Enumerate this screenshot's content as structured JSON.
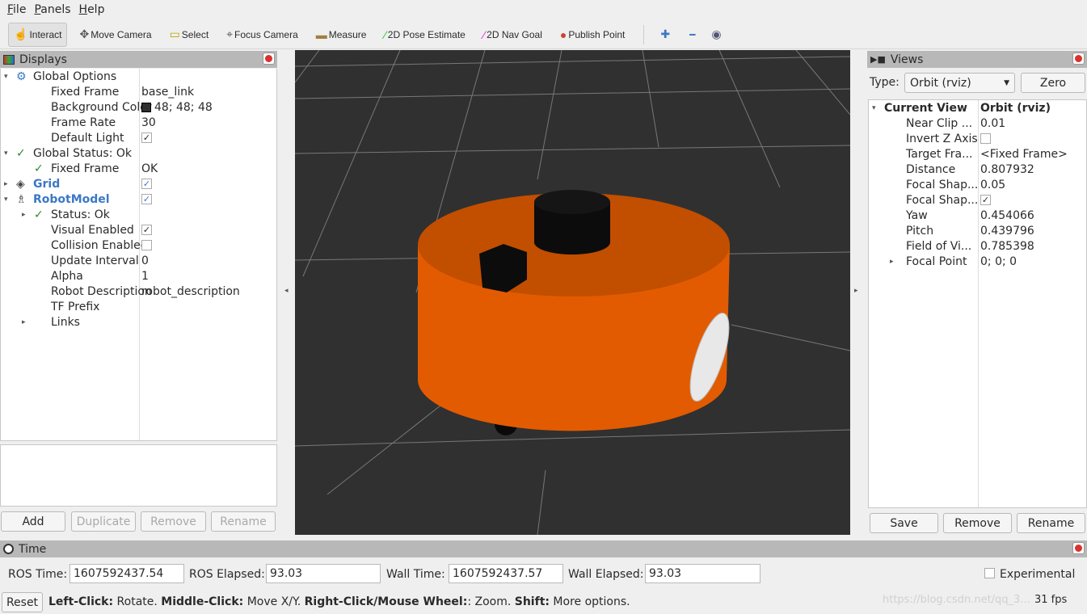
{
  "menu": [
    "File",
    "Panels",
    "Help"
  ],
  "toolbar": {
    "tools": [
      {
        "label": "Interact",
        "icon": "hand-pointer-icon",
        "active": true
      },
      {
        "label": "Move Camera",
        "icon": "move-arrows-icon"
      },
      {
        "label": "Select",
        "icon": "select-box-icon"
      },
      {
        "label": "Focus Camera",
        "icon": "crosshair-icon"
      },
      {
        "label": "Measure",
        "icon": "ruler-icon"
      },
      {
        "label": "2D Pose Estimate",
        "icon": "green-arrow-icon"
      },
      {
        "label": "2D Nav Goal",
        "icon": "magenta-arrow-icon"
      },
      {
        "label": "Publish Point",
        "icon": "map-pin-icon"
      }
    ]
  },
  "displays": {
    "title": "Displays",
    "rows": [
      {
        "k": "Global Options",
        "v": "",
        "indent": 0,
        "arrow": "down",
        "icon": "gear-icon"
      },
      {
        "k": "Fixed Frame",
        "v": "base_link",
        "indent": 1
      },
      {
        "k": "Background Color",
        "v": "48; 48; 48",
        "indent": 1,
        "swatch": "#303030"
      },
      {
        "k": "Frame Rate",
        "v": "30",
        "indent": 1
      },
      {
        "k": "Default Light",
        "check": true,
        "indent": 1
      },
      {
        "k": "Global Status: Ok",
        "v": "",
        "indent": 0,
        "arrow": "down",
        "ok": true
      },
      {
        "k": "Fixed Frame",
        "v": "OK",
        "indent": 1,
        "ok": true
      },
      {
        "k": "Grid",
        "check": true,
        "indent": 0,
        "arrow": "right",
        "icon": "grid-icon",
        "blue": true
      },
      {
        "k": "RobotModel",
        "check": true,
        "indent": 0,
        "arrow": "down",
        "icon": "robot-icon",
        "blue": true
      },
      {
        "k": "Status: Ok",
        "v": "",
        "indent": 1,
        "arrow": "right",
        "ok": true
      },
      {
        "k": "Visual Enabled",
        "check": true,
        "indent": 1
      },
      {
        "k": "Collision Enabled",
        "check": false,
        "indent": 1
      },
      {
        "k": "Update Interval",
        "v": "0",
        "indent": 1
      },
      {
        "k": "Alpha",
        "v": "1",
        "indent": 1
      },
      {
        "k": "Robot Description",
        "v": "robot_description",
        "indent": 1
      },
      {
        "k": "TF Prefix",
        "v": "",
        "indent": 1
      },
      {
        "k": "Links",
        "v": "",
        "indent": 1,
        "arrow": "right"
      }
    ],
    "buttons": {
      "add": "Add",
      "duplicate": "Duplicate",
      "remove": "Remove",
      "rename": "Rename"
    }
  },
  "views": {
    "title": "Views",
    "type_label": "Type:",
    "type_value": "Orbit (rviz)",
    "zero": "Zero",
    "rows": [
      {
        "k": "Current View",
        "v": "Orbit (rviz)",
        "bold": true,
        "arrow": "down"
      },
      {
        "k": "Near Clip ...",
        "v": "0.01"
      },
      {
        "k": "Invert Z Axis",
        "check": false
      },
      {
        "k": "Target Fra...",
        "v": "<Fixed Frame>"
      },
      {
        "k": "Distance",
        "v": "0.807932"
      },
      {
        "k": "Focal Shap...",
        "v": "0.05"
      },
      {
        "k": "Focal Shap...",
        "check": true
      },
      {
        "k": "Yaw",
        "v": "0.454066"
      },
      {
        "k": "Pitch",
        "v": "0.439796"
      },
      {
        "k": "Field of Vi...",
        "v": "0.785398"
      },
      {
        "k": "Focal Point",
        "v": "0; 0; 0",
        "arrow": "right"
      }
    ],
    "buttons": {
      "save": "Save",
      "remove": "Remove",
      "rename": "Rename"
    }
  },
  "time": {
    "title": "Time",
    "ros_time_label": "ROS Time:",
    "ros_time": "1607592437.54",
    "ros_elapsed_label": "ROS Elapsed:",
    "ros_elapsed": "93.03",
    "wall_time_label": "Wall Time:",
    "wall_time": "1607592437.57",
    "wall_elapsed_label": "Wall Elapsed:",
    "wall_elapsed": "93.03",
    "experimental": "Experimental"
  },
  "status": {
    "reset": "Reset",
    "parts": [
      [
        "Left-Click:",
        " Rotate. "
      ],
      [
        "Middle-Click:",
        " Move X/Y. "
      ],
      [
        "Right-Click/Mouse Wheel:",
        ": Zoom. "
      ],
      [
        "Shift:",
        " More options."
      ]
    ],
    "fps": "31 fps",
    "watermark": "https://blog.csdn.net/qq_3..."
  },
  "colors": {
    "background": "#303030",
    "robot_body": "#e65c00",
    "accent_blue": "#3a78c6"
  }
}
